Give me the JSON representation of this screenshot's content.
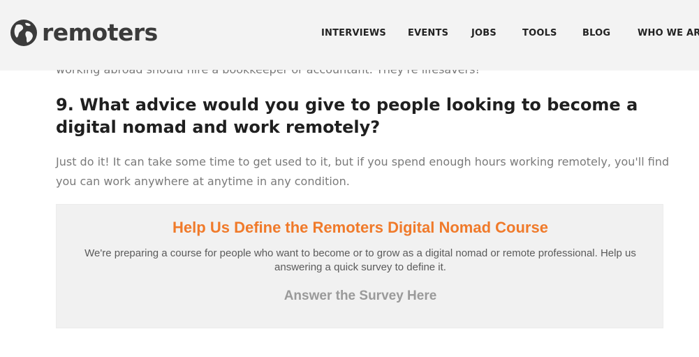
{
  "header": {
    "logo_text": "remoters",
    "logo_icon": "globe-icon",
    "background": "#f3f3f3"
  },
  "nav": {
    "items": [
      {
        "label": "INTERVIEWS"
      },
      {
        "label": "EVENTS"
      },
      {
        "label": "JOBS"
      },
      {
        "label": "TOOLS"
      },
      {
        "label": "BLOG"
      },
      {
        "label": "WHO WE ARE"
      }
    ]
  },
  "article": {
    "clipped_text": "working abroad should hire a bookkeeper or accountant. They're lifesavers!",
    "heading": "9. What advice would you give to people looking to become a digital nomad and work remotely?",
    "answer": "Just do it! It can take some time to get used to it, but if you spend enough hours working remotely, you'll find you can work anywhere at anytime in any condition."
  },
  "cta": {
    "title": "Help Us Define the Remoters Digital Nomad Course",
    "description": "We're preparing a course for people who want to become or to grow as a digital nomad or remote professional. Help us answering a quick survey to define it.",
    "link_label": "Answer the Survey Here",
    "accent_color": "#f07a2a"
  }
}
